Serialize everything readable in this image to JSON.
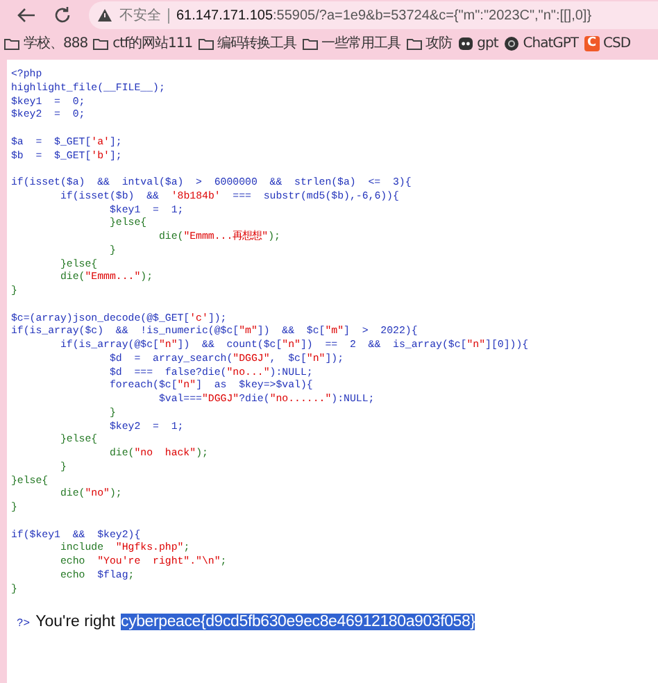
{
  "toolbar": {
    "security_label": "不安全",
    "url_host": "61.147.171.105",
    "url_rest": ":55905/?a=1e9&b=53724&c={\"m\":\"2023C\",\"n\":[[],0]}"
  },
  "bookmarks": [
    {
      "label": "学校、888",
      "kind": "folder"
    },
    {
      "label": "ctf的网站111",
      "kind": "folder"
    },
    {
      "label": "编码转换工具",
      "kind": "folder"
    },
    {
      "label": "一些常用工具",
      "kind": "folder"
    },
    {
      "label": "攻防",
      "kind": "folder"
    },
    {
      "label": "gpt",
      "kind": "bot"
    },
    {
      "label": "ChatGPT",
      "kind": "round"
    },
    {
      "label": "CSD",
      "kind": "letter",
      "icon_letter": "C"
    }
  ],
  "source": {
    "lines": [
      {
        "segments": [
          {
            "text": "<?php",
            "kind": "default"
          }
        ]
      },
      {
        "segments": [
          {
            "text": "highlight_file(__FILE__);",
            "kind": "default"
          }
        ]
      },
      {
        "segments": [
          {
            "text": "$key1  =  0;",
            "kind": "default"
          }
        ]
      },
      {
        "segments": [
          {
            "text": "$key2  =  0;",
            "kind": "default"
          }
        ]
      },
      {
        "after_blank": true,
        "segments": [
          {
            "text": "$a  =  $_GET[",
            "kind": "default"
          },
          {
            "text": "'a'",
            "kind": "string"
          },
          {
            "text": "];",
            "kind": "default"
          }
        ]
      },
      {
        "segments": [
          {
            "text": "$b  =  $_GET[",
            "kind": "default"
          },
          {
            "text": "'b'",
            "kind": "string"
          },
          {
            "text": "];",
            "kind": "default"
          }
        ]
      },
      {
        "after_blank": true,
        "segments": [
          {
            "text": "if(isset($a)  &&  intval($a)  >  6000000  &&  strlen($a)  <=  3){",
            "kind": "default"
          }
        ]
      },
      {
        "segments": [
          {
            "text": "        if(isset($b)  &&  ",
            "kind": "default"
          },
          {
            "text": "'8b184b'",
            "kind": "string"
          },
          {
            "text": "  ===  substr(md5($b),-6,6)){",
            "kind": "default"
          }
        ]
      },
      {
        "segments": [
          {
            "text": "                $key1  =  1;",
            "kind": "default"
          }
        ]
      },
      {
        "segments": [
          {
            "text": "                }else{",
            "kind": "keyword"
          }
        ]
      },
      {
        "segments": [
          {
            "text": "                        die(",
            "kind": "keyword"
          },
          {
            "text": "\"Emmm...再想想\"",
            "kind": "string"
          },
          {
            "text": ");",
            "kind": "keyword"
          }
        ]
      },
      {
        "segments": [
          {
            "text": "                }",
            "kind": "keyword"
          }
        ]
      },
      {
        "segments": [
          {
            "text": "        }else{",
            "kind": "keyword"
          }
        ]
      },
      {
        "segments": [
          {
            "text": "        die(",
            "kind": "keyword"
          },
          {
            "text": "\"Emmm...\"",
            "kind": "string"
          },
          {
            "text": ");",
            "kind": "keyword"
          }
        ]
      },
      {
        "segments": [
          {
            "text": "}",
            "kind": "keyword"
          }
        ]
      },
      {
        "after_blank": true,
        "segments": [
          {
            "text": "$c=(array)json_decode(@$_GET[",
            "kind": "default"
          },
          {
            "text": "'c'",
            "kind": "string"
          },
          {
            "text": "]);",
            "kind": "default"
          }
        ]
      },
      {
        "segments": [
          {
            "text": "if(is_array($c)  &&  !is_numeric(@$c[",
            "kind": "default"
          },
          {
            "text": "\"m\"",
            "kind": "string"
          },
          {
            "text": "])  &&  $c[",
            "kind": "default"
          },
          {
            "text": "\"m\"",
            "kind": "string"
          },
          {
            "text": "]  >  2022){",
            "kind": "default"
          }
        ]
      },
      {
        "segments": [
          {
            "text": "        if(is_array(@$c[",
            "kind": "default"
          },
          {
            "text": "\"n\"",
            "kind": "string"
          },
          {
            "text": "])  &&  count($c[",
            "kind": "default"
          },
          {
            "text": "\"n\"",
            "kind": "string"
          },
          {
            "text": "])  ==  2  &&  is_array($c[",
            "kind": "default"
          },
          {
            "text": "\"n\"",
            "kind": "string"
          },
          {
            "text": "][0])){",
            "kind": "default"
          }
        ]
      },
      {
        "segments": [
          {
            "text": "                $d  =  array_search(",
            "kind": "default"
          },
          {
            "text": "\"DGGJ\"",
            "kind": "string"
          },
          {
            "text": ",  $c[",
            "kind": "default"
          },
          {
            "text": "\"n\"",
            "kind": "string"
          },
          {
            "text": "]);",
            "kind": "default"
          }
        ]
      },
      {
        "segments": [
          {
            "text": "                $d  ===  false?die(",
            "kind": "default"
          },
          {
            "text": "\"no...\"",
            "kind": "string"
          },
          {
            "text": "):NULL;",
            "kind": "default"
          }
        ]
      },
      {
        "segments": [
          {
            "text": "                foreach($c[",
            "kind": "default"
          },
          {
            "text": "\"n\"",
            "kind": "string"
          },
          {
            "text": "]  as  $key=>$val){",
            "kind": "default"
          }
        ]
      },
      {
        "segments": [
          {
            "text": "                        $val===",
            "kind": "default"
          },
          {
            "text": "\"DGGJ\"",
            "kind": "string"
          },
          {
            "text": "?die(",
            "kind": "default"
          },
          {
            "text": "\"no......\"",
            "kind": "string"
          },
          {
            "text": "):NULL;",
            "kind": "default"
          }
        ]
      },
      {
        "segments": [
          {
            "text": "                }",
            "kind": "keyword"
          }
        ]
      },
      {
        "segments": [
          {
            "text": "                $key2  =  1;",
            "kind": "default"
          }
        ]
      },
      {
        "segments": [
          {
            "text": "        }else{",
            "kind": "keyword"
          }
        ]
      },
      {
        "segments": [
          {
            "text": "                die(",
            "kind": "keyword"
          },
          {
            "text": "\"no  hack\"",
            "kind": "string"
          },
          {
            "text": ");",
            "kind": "keyword"
          }
        ]
      },
      {
        "segments": [
          {
            "text": "        }",
            "kind": "keyword"
          }
        ]
      },
      {
        "segments": [
          {
            "text": "}else{",
            "kind": "keyword"
          }
        ]
      },
      {
        "segments": [
          {
            "text": "        die(",
            "kind": "keyword"
          },
          {
            "text": "\"no\"",
            "kind": "string"
          },
          {
            "text": ");",
            "kind": "keyword"
          }
        ]
      },
      {
        "segments": [
          {
            "text": "}",
            "kind": "keyword"
          }
        ]
      },
      {
        "after_blank": true,
        "segments": [
          {
            "text": "if($key1  &&  $key2){",
            "kind": "default"
          }
        ]
      },
      {
        "segments": [
          {
            "text": "        include  ",
            "kind": "keyword"
          },
          {
            "text": "\"Hgfks.php\"",
            "kind": "string"
          },
          {
            "text": ";",
            "kind": "keyword"
          }
        ]
      },
      {
        "segments": [
          {
            "text": "        echo  ",
            "kind": "keyword"
          },
          {
            "text": "\"You're  right\".\"\\n\"",
            "kind": "string"
          },
          {
            "text": ";",
            "kind": "keyword"
          }
        ]
      },
      {
        "segments": [
          {
            "text": "        echo  ",
            "kind": "keyword"
          },
          {
            "text": "$flag",
            "kind": "default"
          },
          {
            "text": ";",
            "kind": "keyword"
          }
        ]
      },
      {
        "segments": [
          {
            "text": "}",
            "kind": "keyword"
          }
        ]
      }
    ]
  },
  "output": {
    "closing_tag": "?>",
    "message": "You're right",
    "flag": "cyberpeace{d9cd5fb630e9ec8e46912180a903f058}",
    "flag_selected": true
  }
}
